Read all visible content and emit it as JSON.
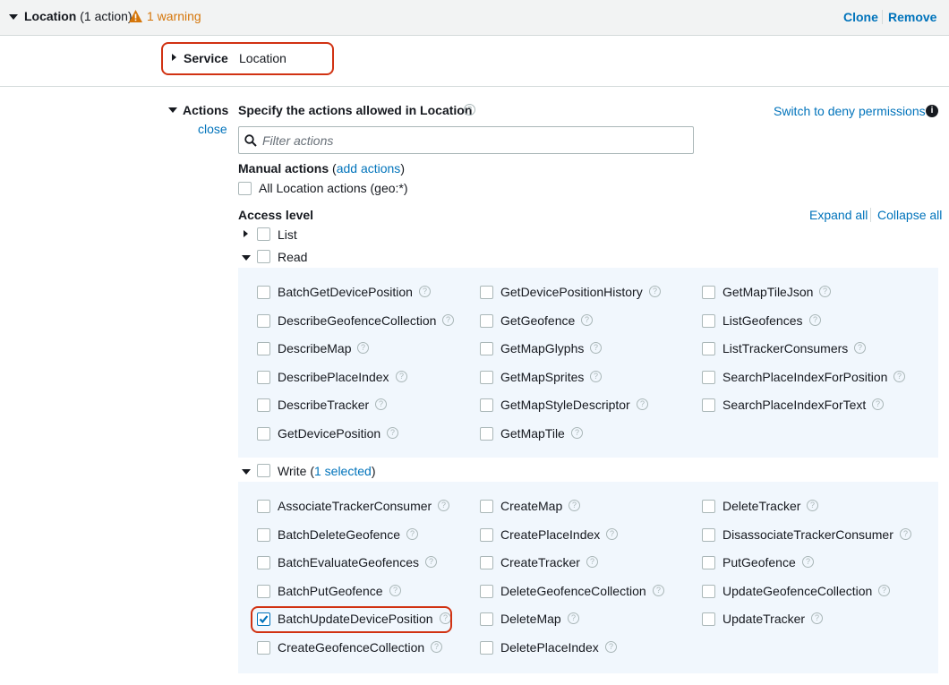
{
  "header": {
    "title": "Location",
    "action_count": "(1 action)",
    "warning": "1 warning",
    "clone_label": "Clone",
    "remove_label": "Remove"
  },
  "service": {
    "label": "Service",
    "value": "Location"
  },
  "actions": {
    "label": "Actions",
    "close_label": "close",
    "heading": "Specify the actions allowed in Location",
    "switch_label": "Switch to deny permissions",
    "filter_placeholder": "Filter actions",
    "manual_label": "Manual actions",
    "manual_paren_open": "(",
    "add_actions_label": "add actions",
    "manual_paren_close": ")",
    "all_actions_label": "All Location actions (geo:*)",
    "access_level_label": "Access level",
    "expand_all_label": "Expand all",
    "collapse_all_label": "Collapse all"
  },
  "groups": {
    "list": {
      "label": "List"
    },
    "read": {
      "label": "Read",
      "items": [
        "BatchGetDevicePosition",
        "GetDevicePositionHistory",
        "GetMapTileJson",
        "DescribeGeofenceCollection",
        "GetGeofence",
        "ListGeofences",
        "DescribeMap",
        "GetMapGlyphs",
        "ListTrackerConsumers",
        "DescribePlaceIndex",
        "GetMapSprites",
        "SearchPlaceIndexForPosition",
        "DescribeTracker",
        "GetMapStyleDescriptor",
        "SearchPlaceIndexForText",
        "GetDevicePosition",
        "GetMapTile"
      ]
    },
    "write": {
      "label": "Write",
      "paren_open": "(",
      "selected_label": "1 selected",
      "paren_close": ")",
      "items": [
        "AssociateTrackerConsumer",
        "CreateMap",
        "DeleteTracker",
        "BatchDeleteGeofence",
        "CreatePlaceIndex",
        "DisassociateTrackerConsumer",
        "BatchEvaluateGeofences",
        "CreateTracker",
        "PutGeofence",
        "BatchPutGeofence",
        "DeleteGeofenceCollection",
        "UpdateGeofenceCollection",
        "BatchUpdateDevicePosition",
        "DeleteMap",
        "UpdateTracker",
        "CreateGeofenceCollection",
        "DeletePlaceIndex"
      ],
      "checked": [
        "BatchUpdateDevicePosition"
      ]
    }
  },
  "help_glyph": "?",
  "info_glyph": "i",
  "colors": {
    "link": "#0073bb",
    "warning": "#d5760a",
    "highlight": "#d13212",
    "panel": "#f1f7fd"
  }
}
